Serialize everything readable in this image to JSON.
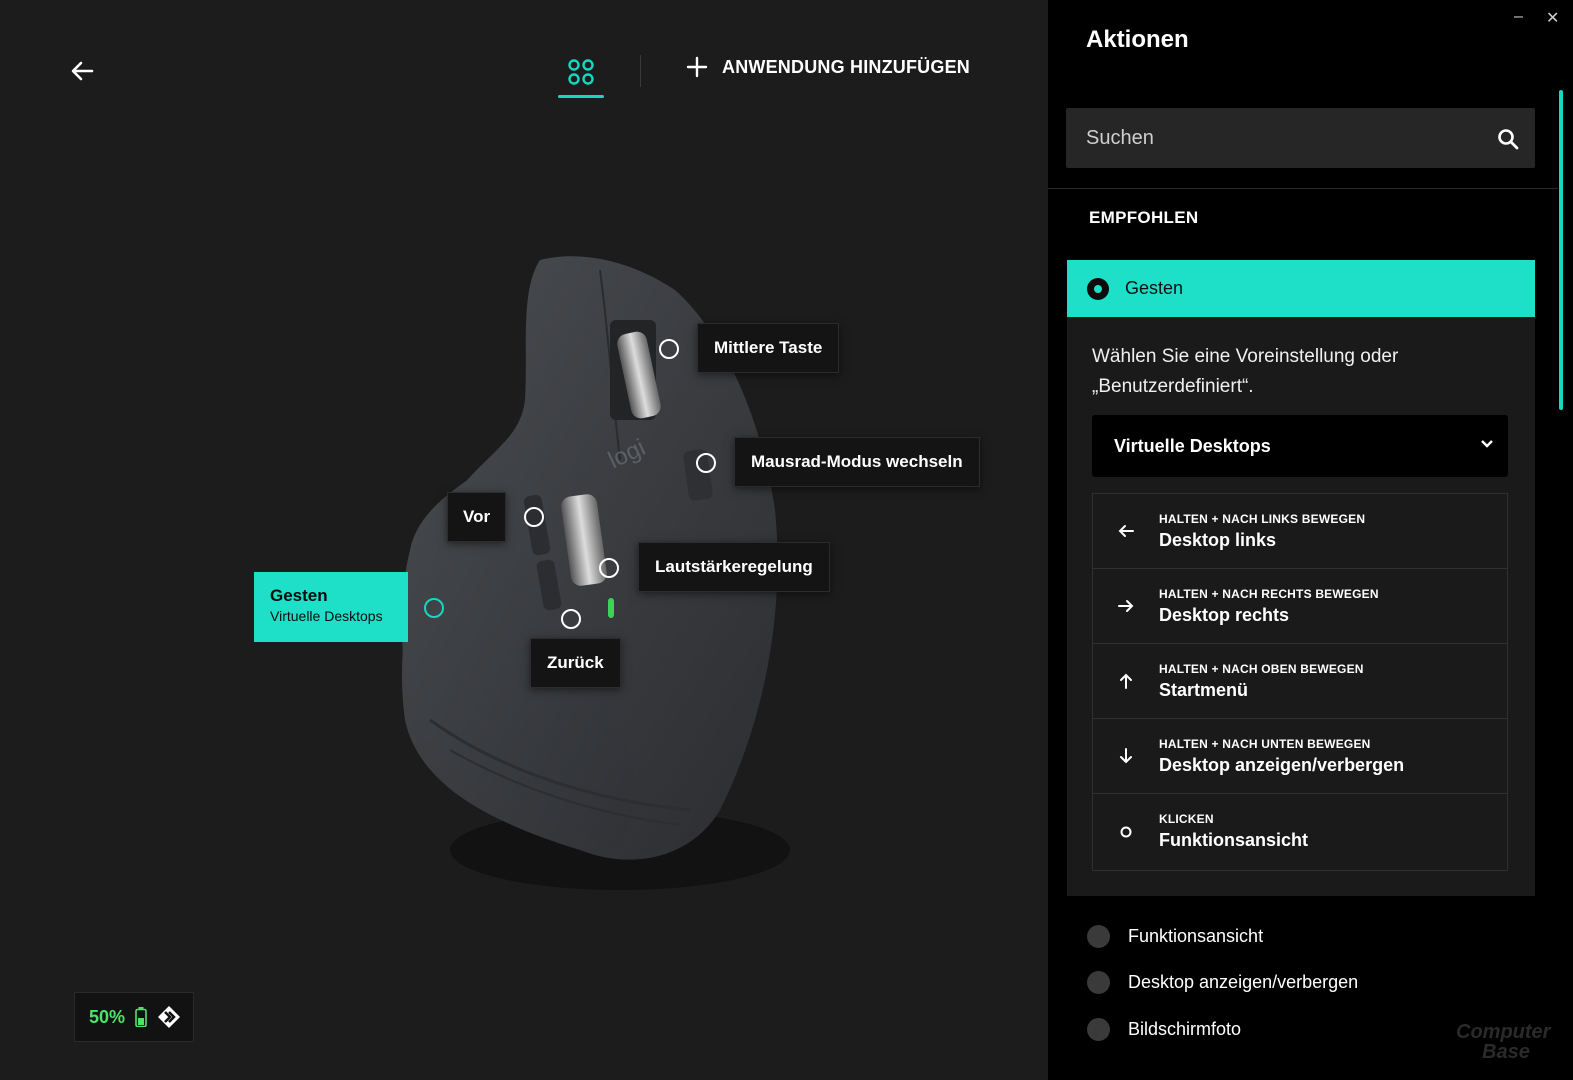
{
  "header": {
    "add_app_label": "ANWENDUNG HINZUFÜGEN"
  },
  "mouse_labels": {
    "middle_button": "Mittlere Taste",
    "wheel_mode": "Mausrad-Modus wechseln",
    "forward": "Vor",
    "volume": "Lautstärkeregelung",
    "back": "Zurück",
    "gesture_title": "Gesten",
    "gesture_sub": "Virtuelle Desktops",
    "logo_text": "logi"
  },
  "battery": {
    "percent_label": "50%",
    "level": 0.5
  },
  "panel": {
    "minimize": "–",
    "close": "✕",
    "title": "Aktionen",
    "search_placeholder": "Suchen",
    "section_title": "EMPFOHLEN",
    "selected_action": "Gesten",
    "description": "Wählen Sie eine Voreinstellung oder „Benutzerdefiniert“.",
    "preset_value": "Virtuelle Desktops",
    "gesture_items": [
      {
        "icon": "arrow-left-icon",
        "hint": "HALTEN + NACH LINKS BEWEGEN",
        "action": "Desktop links"
      },
      {
        "icon": "arrow-right-icon",
        "hint": "HALTEN + NACH RECHTS BEWEGEN",
        "action": "Desktop rechts"
      },
      {
        "icon": "arrow-up-icon",
        "hint": "HALTEN + NACH OBEN BEWEGEN",
        "action": "Startmenü"
      },
      {
        "icon": "arrow-down-icon",
        "hint": "HALTEN + NACH UNTEN BEWEGEN",
        "action": "Desktop anzeigen/verbergen"
      },
      {
        "icon": "circle-icon",
        "hint": "KLICKEN",
        "action": "Funktionsansicht"
      }
    ],
    "other_actions": [
      "Funktionsansicht",
      "Desktop anzeigen/verbergen",
      "Bildschirmfoto"
    ],
    "watermark_line1": "Computer",
    "watermark_line2": "Base"
  },
  "colors": {
    "accent": "#1ee0c8",
    "battery_green": "#4de36a",
    "panel_bg": "#000000",
    "canvas_bg": "#1c1c1c"
  }
}
